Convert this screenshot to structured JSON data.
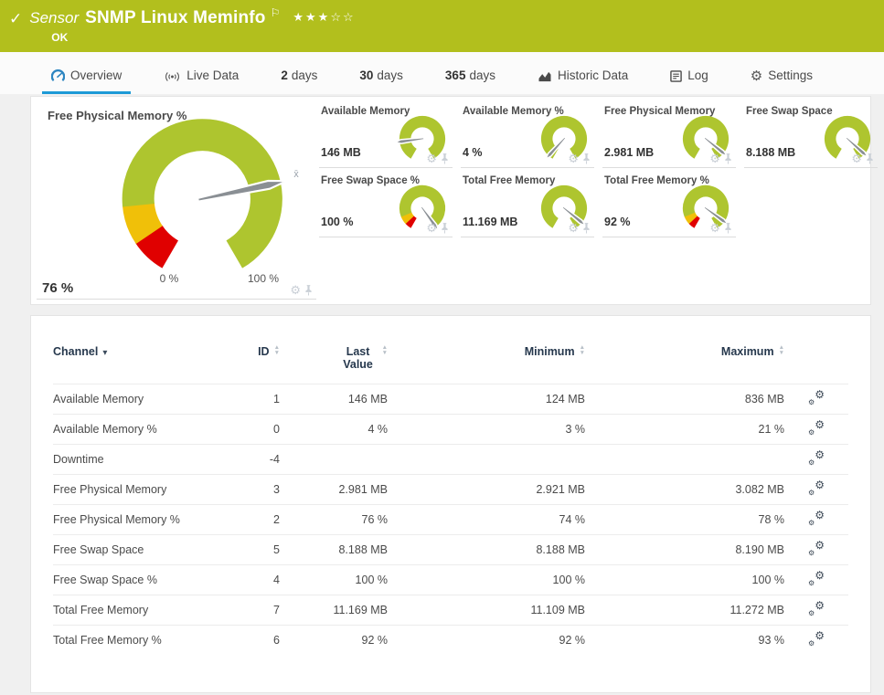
{
  "header": {
    "type_label": "Sensor",
    "title": "SNMP Linux Meminfo",
    "status": "OK",
    "rating": {
      "filled": 3,
      "total": 5
    }
  },
  "tabs": [
    {
      "label": "Overview",
      "icon": "gauge-icon",
      "active": true
    },
    {
      "label": "Live Data",
      "icon": "live-data-icon"
    },
    {
      "num": "2",
      "label": "days"
    },
    {
      "num": "30",
      "label": "days"
    },
    {
      "num": "365",
      "label": "days"
    },
    {
      "label": "Historic Data",
      "icon": "historic-chart-icon"
    },
    {
      "label": "Log",
      "icon": "log-icon"
    },
    {
      "label": "Settings",
      "icon": "gear-icon"
    }
  ],
  "primary_gauge": {
    "title": "Free Physical Memory %",
    "value": "76 %",
    "min_label": "0 %",
    "max_label": "100 %",
    "needle_fraction": 0.76,
    "segments": [
      [
        0,
        0.09,
        "red"
      ],
      [
        0.09,
        0.185,
        "yellow"
      ],
      [
        0.185,
        1,
        "green"
      ]
    ]
  },
  "small_gauges": [
    {
      "title": "Available Memory",
      "value": "146 MB",
      "needle_fraction": 0.175,
      "segments": [
        [
          0,
          1,
          "green"
        ]
      ]
    },
    {
      "title": "Available Memory %",
      "value": "4 %",
      "needle_fraction": 0.04,
      "segments": [
        [
          0,
          1,
          "green"
        ]
      ]
    },
    {
      "title": "Free Physical Memory",
      "value": "2.981 MB",
      "needle_fraction": 0.93,
      "segments": [
        [
          0,
          1,
          "green"
        ]
      ]
    },
    {
      "title": "Free Swap Space",
      "value": "8.188 MB",
      "needle_fraction": 0.94,
      "segments": [
        [
          0,
          1,
          "green"
        ]
      ]
    },
    {
      "title": "Free Swap Space %",
      "value": "100 %",
      "needle_fraction": 0.98,
      "segments": [
        [
          0,
          0.06,
          "red"
        ],
        [
          0.06,
          0.13,
          "yellow"
        ],
        [
          0.13,
          1,
          "green"
        ]
      ]
    },
    {
      "title": "Total Free Memory",
      "value": "11.169 MB",
      "needle_fraction": 0.93,
      "segments": [
        [
          0,
          1,
          "green"
        ]
      ]
    },
    {
      "title": "Total Free Memory %",
      "value": "92 %",
      "needle_fraction": 0.92,
      "segments": [
        [
          0,
          0.06,
          "red"
        ],
        [
          0.06,
          0.13,
          "yellow"
        ],
        [
          0.13,
          1,
          "green"
        ]
      ]
    }
  ],
  "table": {
    "columns": [
      "Channel",
      "ID",
      "Last Value",
      "Minimum",
      "Maximum"
    ],
    "rows": [
      {
        "channel": "Available Memory",
        "id": "1",
        "last": "146 MB",
        "min": "124 MB",
        "max": "836 MB"
      },
      {
        "channel": "Available Memory %",
        "id": "0",
        "last": "4 %",
        "min": "3 %",
        "max": "21 %"
      },
      {
        "channel": "Downtime",
        "id": "-4",
        "last": "",
        "min": "",
        "max": ""
      },
      {
        "channel": "Free Physical Memory",
        "id": "3",
        "last": "2.981 MB",
        "min": "2.921 MB",
        "max": "3.082 MB"
      },
      {
        "channel": "Free Physical Memory %",
        "id": "2",
        "last": "76 %",
        "min": "74 %",
        "max": "78 %"
      },
      {
        "channel": "Free Swap Space",
        "id": "5",
        "last": "8.188 MB",
        "min": "8.188 MB",
        "max": "8.190 MB"
      },
      {
        "channel": "Free Swap Space %",
        "id": "4",
        "last": "100 %",
        "min": "100 %",
        "max": "100 %"
      },
      {
        "channel": "Total Free Memory",
        "id": "7",
        "last": "11.169 MB",
        "min": "11.109 MB",
        "max": "11.272 MB"
      },
      {
        "channel": "Total Free Memory %",
        "id": "6",
        "last": "92 %",
        "min": "92 %",
        "max": "93 %"
      }
    ]
  },
  "icons": {
    "check": "✓",
    "flag": "⚐",
    "star_filled": "★",
    "star_empty": "☆",
    "gear": "⚙",
    "caret_down": "▾",
    "sort_up": "▲",
    "sort_down": "▼",
    "avg_marker": "x̄"
  },
  "colors": {
    "header_green": "#b2bf1d",
    "green": "#aec52f",
    "yellow": "#f0c009",
    "red": "#e00000",
    "accent_blue": "#1d9ad6",
    "needle": "#8a8f94"
  }
}
